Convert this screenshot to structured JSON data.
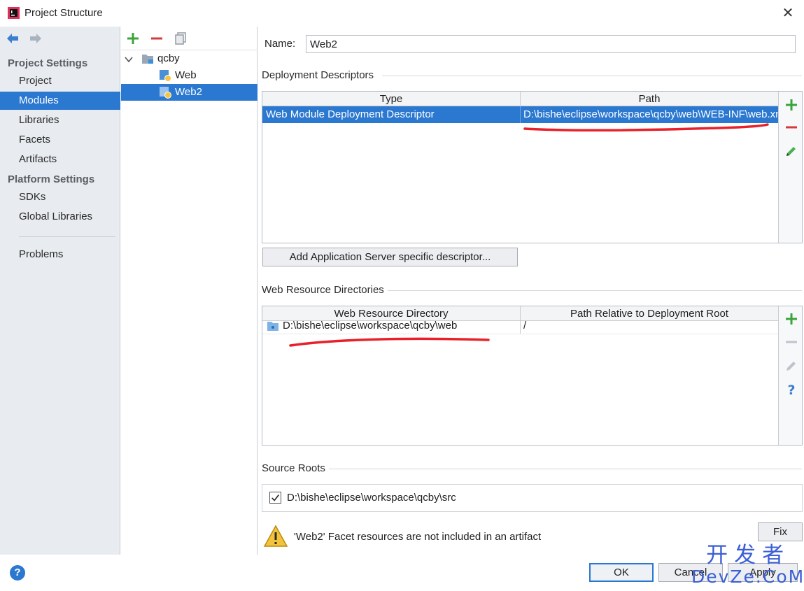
{
  "window": {
    "title": "Project Structure",
    "close_glyph": "✕"
  },
  "sidebar": {
    "project_settings_heading": "Project Settings",
    "project_items": [
      {
        "label": "Project"
      },
      {
        "label": "Modules"
      },
      {
        "label": "Libraries"
      },
      {
        "label": "Facets"
      },
      {
        "label": "Artifacts"
      }
    ],
    "platform_settings_heading": "Platform Settings",
    "platform_items": [
      {
        "label": "SDKs"
      },
      {
        "label": "Global Libraries"
      }
    ],
    "problems_label": "Problems",
    "selected": "Modules"
  },
  "tree": {
    "root": "qcby",
    "children": [
      {
        "label": "Web"
      },
      {
        "label": "Web2"
      }
    ],
    "selected": "Web2"
  },
  "module": {
    "name_label": "Name:",
    "name_value": "Web2"
  },
  "deployment_descriptors": {
    "title": "Deployment Descriptors",
    "columns": [
      "Type",
      "Path"
    ],
    "rows": [
      {
        "type": "Web Module Deployment Descriptor",
        "path": "D:\\bishe\\eclipse\\workspace\\qcby\\web\\WEB-INF\\web.xml"
      }
    ],
    "add_server_button": "Add Application Server specific descriptor..."
  },
  "web_resource_directories": {
    "title": "Web Resource Directories",
    "columns": [
      "Web Resource Directory",
      "Path Relative to Deployment Root"
    ],
    "rows": [
      {
        "dir": "D:\\bishe\\eclipse\\workspace\\qcby\\web",
        "relative": "/"
      }
    ]
  },
  "source_roots": {
    "title": "Source Roots",
    "items": [
      {
        "path": "D:\\bishe\\eclipse\\workspace\\qcby\\src",
        "checked": true
      }
    ]
  },
  "warning": {
    "text": "'Web2' Facet resources are not included in an artifact",
    "fix_button": "Fix"
  },
  "footer": {
    "ok": "OK",
    "cancel": "Cancel",
    "apply": "Apply",
    "help": "?"
  },
  "watermark": {
    "cn": "开发者",
    "en": "DevZe.CoM"
  },
  "colors": {
    "selection": "#2b78d0",
    "add": "#3aa33a",
    "remove": "#d63a3a",
    "annotation": "#e8202a"
  }
}
